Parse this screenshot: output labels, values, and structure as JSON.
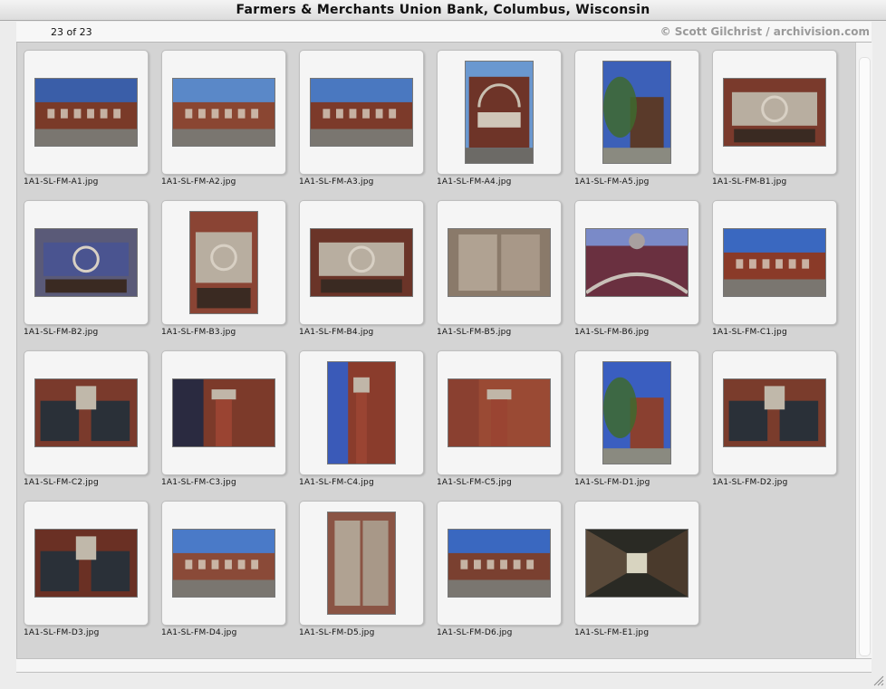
{
  "window": {
    "title": "Farmers & Merchants Union Bank, Columbus, Wisconsin"
  },
  "info": {
    "counter": "23 of 23",
    "credit": "© Scott Gilchrist / archivision.com"
  },
  "thumbnails": [
    {
      "filename": "1A1-SL-FM-A1.jpg",
      "orientation": "landscape",
      "scene": "street",
      "sky": "#3a5ea8",
      "wall": "#7a3a28"
    },
    {
      "filename": "1A1-SL-FM-A2.jpg",
      "orientation": "landscape",
      "scene": "street",
      "sky": "#5a88c8",
      "wall": "#8a4632"
    },
    {
      "filename": "1A1-SL-FM-A3.jpg",
      "orientation": "landscape",
      "scene": "street",
      "sky": "#4a78c0",
      "wall": "#7c3a2a"
    },
    {
      "filename": "1A1-SL-FM-A4.jpg",
      "orientation": "portrait",
      "scene": "facade",
      "sky": "#6a98d0",
      "wall": "#6e3428"
    },
    {
      "filename": "1A1-SL-FM-A5.jpg",
      "orientation": "portrait",
      "scene": "tree",
      "sky": "#3c60b8",
      "wall": "#5a3a2a"
    },
    {
      "filename": "1A1-SL-FM-B1.jpg",
      "orientation": "landscape",
      "scene": "ornament",
      "sky": "#8a4030",
      "wall": "#7a3a2c"
    },
    {
      "filename": "1A1-SL-FM-B2.jpg",
      "orientation": "landscape",
      "scene": "sign",
      "sky": "#3a4a80",
      "wall": "#5a5a78"
    },
    {
      "filename": "1A1-SL-FM-B3.jpg",
      "orientation": "portrait",
      "scene": "ornament",
      "sky": "#7a3a2c",
      "wall": "#8a4434"
    },
    {
      "filename": "1A1-SL-FM-B4.jpg",
      "orientation": "landscape",
      "scene": "ornament",
      "sky": "#2a3a70",
      "wall": "#6a3428"
    },
    {
      "filename": "1A1-SL-FM-B5.jpg",
      "orientation": "landscape",
      "scene": "panel",
      "sky": "#a89888",
      "wall": "#8a7a6a"
    },
    {
      "filename": "1A1-SL-FM-B6.jpg",
      "orientation": "landscape",
      "scene": "arch",
      "sky": "#7a8ac8",
      "wall": "#6a3040"
    },
    {
      "filename": "1A1-SL-FM-C1.jpg",
      "orientation": "landscape",
      "scene": "building",
      "sky": "#3a68c0",
      "wall": "#8a3a28"
    },
    {
      "filename": "1A1-SL-FM-C2.jpg",
      "orientation": "landscape",
      "scene": "windows",
      "sky": "#8a4632",
      "wall": "#7a3a2c"
    },
    {
      "filename": "1A1-SL-FM-C3.jpg",
      "orientation": "landscape",
      "scene": "pier",
      "sky": "#2a2a40",
      "wall": "#7c3a2a"
    },
    {
      "filename": "1A1-SL-FM-C4.jpg",
      "orientation": "portrait",
      "scene": "corner",
      "sky": "#3a5ab8",
      "wall": "#8a3c2c"
    },
    {
      "filename": "1A1-SL-FM-C5.jpg",
      "orientation": "landscape",
      "scene": "capital",
      "sky": "#8a4030",
      "wall": "#9a4a34"
    },
    {
      "filename": "1A1-SL-FM-D1.jpg",
      "orientation": "portrait",
      "scene": "tree",
      "sky": "#3a5ec0",
      "wall": "#8a4030"
    },
    {
      "filename": "1A1-SL-FM-D2.jpg",
      "orientation": "landscape",
      "scene": "windows",
      "sky": "#8a4432",
      "wall": "#7a3c2c"
    },
    {
      "filename": "1A1-SL-FM-D3.jpg",
      "orientation": "landscape",
      "scene": "windows",
      "sky": "#7a3a2a",
      "wall": "#6a3024"
    },
    {
      "filename": "1A1-SL-FM-D4.jpg",
      "orientation": "landscape",
      "scene": "street",
      "sky": "#4a7ac8",
      "wall": "#8a4a38"
    },
    {
      "filename": "1A1-SL-FM-D5.jpg",
      "orientation": "portrait",
      "scene": "panel",
      "sky": "#6a3a2c",
      "wall": "#8a5444"
    },
    {
      "filename": "1A1-SL-FM-D6.jpg",
      "orientation": "landscape",
      "scene": "street",
      "sky": "#3a68c0",
      "wall": "#7a4030"
    },
    {
      "filename": "1A1-SL-FM-E1.jpg",
      "orientation": "landscape",
      "scene": "corridor",
      "sky": "#2a2a24",
      "wall": "#5a4a3a"
    }
  ]
}
